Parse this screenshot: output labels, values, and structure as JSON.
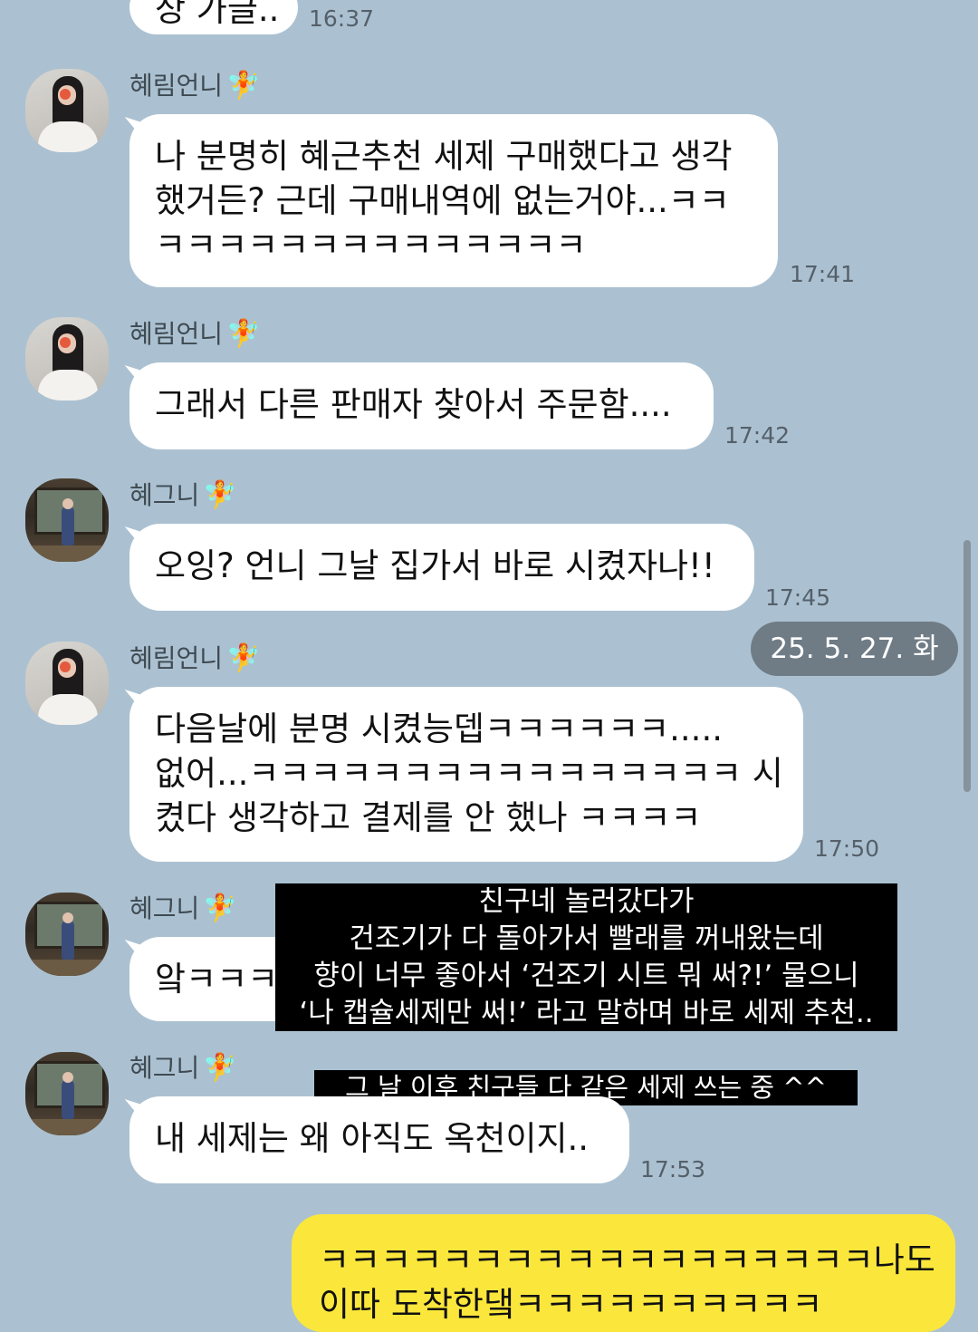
{
  "top_partial": {
    "text": "상 가글..",
    "time": "16:37"
  },
  "messages": [
    {
      "sender": "혜림언니",
      "lines": [
        "나 분명히 혜근추천 세제 구매했다고 생각",
        "했거든? 근데 구매내역에 없는거야...ㅋㅋ",
        "ㅋㅋㅋㅋㅋㅋㅋㅋㅋㅋㅋㅋㅋㅋ"
      ],
      "time": "17:41"
    },
    {
      "sender": "혜림언니",
      "lines": [
        "그래서 다른 판매자 찾아서 주문함...."
      ],
      "time": "17:42"
    },
    {
      "sender": "혜그니",
      "lines": [
        "오잉? 언니 그날 집가서 바로 시켰자나!!"
      ],
      "time": "17:45"
    },
    {
      "sender": "혜림언니",
      "lines": [
        "다음날에 분명 시켰능뎁ㅋㅋㅋㅋㅋㅋ.....",
        "없어...ㅋㅋㅋㅋㅋㅋㅋㅋㅋㅋㅋㅋㅋㅋㅋㅋ 시",
        "켰다 생각하고 결제를 안 했나 ㅋㅋㅋㅋ"
      ],
      "time": "17:50"
    },
    {
      "sender": "혜그니",
      "lines": [
        "앜ㅋㅋㅋ"
      ],
      "time": ""
    },
    {
      "sender": "혜그니",
      "lines": [
        "내 세제는 왜 아직도 옥천이지.."
      ],
      "time": "17:53"
    }
  ],
  "date_divider": "25. 5. 27. 화",
  "caption_main": [
    "친구네 놀러갔다가",
    "건조기가 다 돌아가서 빨래를 꺼내왔는데",
    "향이 너무 좋아서 ‘건조기 시트 뭐 써?!’ 물으니",
    "‘나 캡슐세제만 써!’ 라고 말하며 바로 세제 추천.."
  ],
  "caption_small": "그 날 이후 친구들 다 같은 세제 쓰는 중 ^^",
  "my_message": [
    "ㅋㅋㅋㅋㅋㅋㅋㅋㅋㅋㅋㅋㅋㅋㅋㅋㅋㅋ나도",
    "이따 도착한댘ㅋㅋㅋㅋㅋㅋㅋㅋㅋㅋ"
  ],
  "icons": {
    "fairy": "fairy-emoji",
    "colors": {
      "background": "#abc1d1",
      "my_bubble": "#fbe73c",
      "their_bubble": "#ffffff"
    }
  }
}
